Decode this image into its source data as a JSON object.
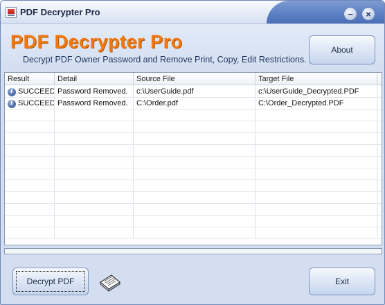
{
  "window": {
    "title": "PDF Decrypter Pro",
    "minimize_glyph": "−",
    "close_glyph": "×"
  },
  "header": {
    "app_title": "PDF Decrypter Pro",
    "subtitle": "Decrypt PDF Owner Password and Remove Print, Copy, Edit  Restrictions.",
    "about_label": "About"
  },
  "table": {
    "columns": [
      "Result",
      "Detail",
      "Source File",
      "Target File"
    ],
    "rows": [
      {
        "result": "SUCCEED",
        "detail": "Password Removed.",
        "source": "c:\\UserGuide.pdf",
        "target": "c:\\UserGuide_Decrypted.PDF"
      },
      {
        "result": "SUCCEED",
        "detail": "Password Removed.",
        "source": "C:\\Order.pdf",
        "target": "C:\\Order_Decrypted.PDF"
      }
    ],
    "empty_rows": 11
  },
  "progress": {
    "value": 0
  },
  "footer": {
    "decrypt_label": "Decrypt PDF",
    "exit_label": "Exit"
  },
  "colors": {
    "title_orange": "#f07a10",
    "window_bg": "#d3dff1",
    "info_icon": "#2c4f95"
  },
  "icons": {
    "app": "pdf-app-icon",
    "status": "info-icon",
    "decrypt_graphic": "paper-document-icon"
  }
}
